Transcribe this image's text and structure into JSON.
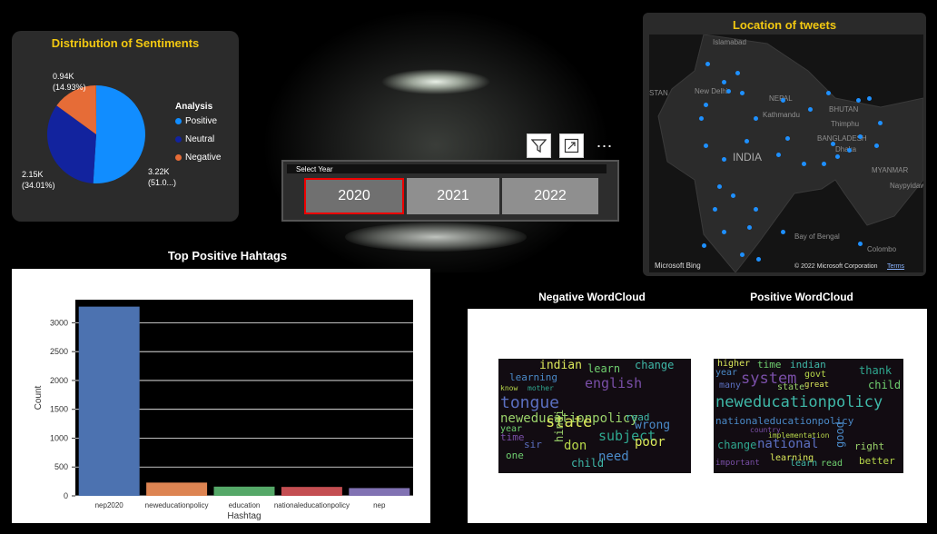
{
  "sentiment": {
    "title": "Distribution of Sentiments",
    "slices": [
      {
        "label": "Positive",
        "value_text": "3.22K",
        "pct_text": "(51.0...)",
        "fraction": 0.51,
        "color": "#118dff"
      },
      {
        "label": "Neutral",
        "value_text": "2.15K",
        "pct_text": "(34.01%)",
        "fraction": 0.3401,
        "color": "#12239e"
      },
      {
        "label": "Negative",
        "value_text": "0.94K",
        "pct_text": "(14.93%)",
        "fraction": 0.1493,
        "color": "#e66c37"
      }
    ],
    "legend_title": "Analysis"
  },
  "map": {
    "title": "Location of tweets",
    "labels": [
      "Islamabad",
      "STAN",
      "New Delhi",
      "NEPAL",
      "Kathmandu",
      "BHUTAN",
      "Thimphu",
      "BANGLADESH",
      "Dhaka",
      "INDIA",
      "MYANMAR",
      "Naypyidaw",
      "Bay of Bengal",
      "Colombo"
    ],
    "footer_logo": "Microsoft Bing",
    "copyright": "© 2022 Microsoft Corporation",
    "terms": "Terms",
    "dot_color": "#1e90ff"
  },
  "slicer": {
    "label": "Select Year",
    "years": [
      "2020",
      "2021",
      "2022"
    ],
    "selected": "2020"
  },
  "toolbar_icons": [
    "filter-icon",
    "focus-mode-icon",
    "more-options-icon"
  ],
  "chart_data": {
    "type": "bar",
    "title": "Top Positive Hahtags",
    "xlabel": "Hashtag",
    "ylabel": "Count",
    "categories": [
      "nep2020",
      "neweducationpolicy",
      "education",
      "nationaleducationpolicy",
      "nep"
    ],
    "values": [
      3280,
      230,
      160,
      155,
      135
    ],
    "colors": [
      "#4c72b0",
      "#dd8452",
      "#55a868",
      "#c44e52",
      "#8172b3"
    ],
    "ylim": [
      0,
      3400
    ],
    "yticks": [
      0,
      500,
      1000,
      1500,
      2000,
      2500,
      3000
    ],
    "grid": true
  },
  "wordclouds": {
    "negative_title": "Negative WordCloud",
    "positive_title": "Positive WordCloud",
    "negative_words": [
      "indian",
      "learn",
      "change",
      "learning",
      "english",
      "know",
      "mother",
      "tongue",
      "neweducationpolicy",
      "state",
      "year",
      "read",
      "wrong",
      "time",
      "don",
      "subject",
      "sir",
      "hindi",
      "poor",
      "one",
      "child",
      "need"
    ],
    "positive_words": [
      "higher",
      "time",
      "indian",
      "year",
      "system",
      "govt",
      "thank",
      "many",
      "state",
      "great",
      "child",
      "neweducationpolicy",
      "nationaleducationpolicy",
      "country",
      "implementation",
      "change",
      "national",
      "right",
      "learning",
      "read",
      "learn",
      "good",
      "important",
      "better"
    ]
  }
}
